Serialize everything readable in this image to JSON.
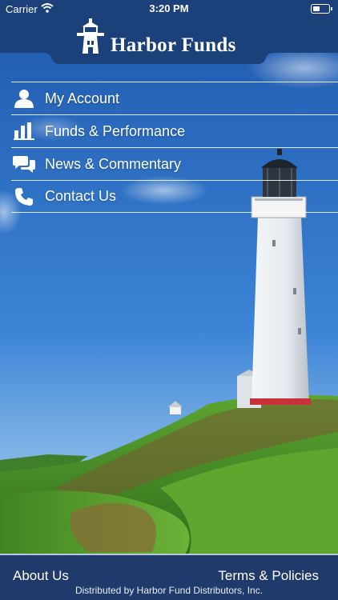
{
  "status_bar": {
    "carrier": "Carrier",
    "time": "3:20 PM",
    "wifi_icon": "wifi-icon",
    "battery_icon": "battery-icon"
  },
  "header": {
    "logo_icon": "lighthouse-logo-icon",
    "title": "Harbor Funds"
  },
  "menu": {
    "items": [
      {
        "label": "My Account",
        "icon": "person-icon"
      },
      {
        "label": "Funds & Performance",
        "icon": "bar-chart-icon"
      },
      {
        "label": "News & Commentary",
        "icon": "chat-bubbles-icon"
      },
      {
        "label": "Contact Us",
        "icon": "phone-icon"
      }
    ]
  },
  "footer": {
    "about_label": "About Us",
    "terms_label": "Terms & Policies",
    "distributed_text": "Distributed by Harbor Fund Distributors, Inc."
  },
  "colors": {
    "header_blue": "#1c3f78",
    "footer_blue": "#1f3a6b",
    "sky_top": "#1f5cb2",
    "sky_bottom": "#7fb2e6",
    "grass": "#4f9a2a"
  }
}
